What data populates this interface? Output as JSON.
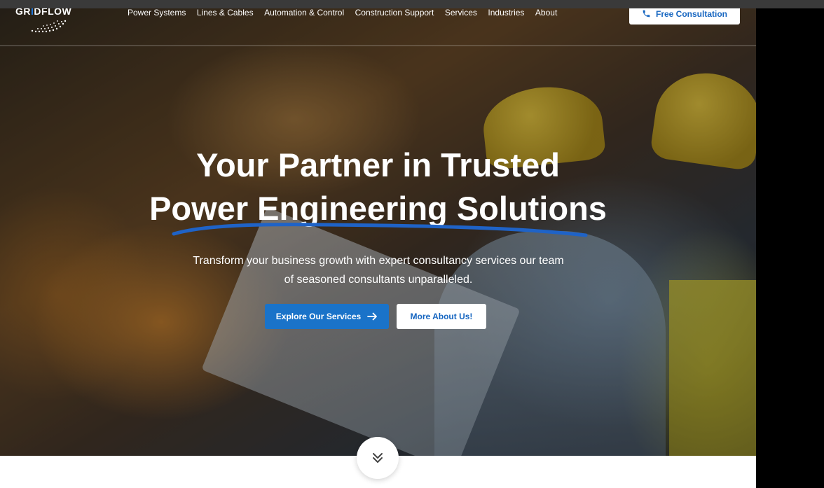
{
  "header": {
    "logo": {
      "text_left": "GR",
      "text_accent": "I",
      "text_mid": "D",
      "text_right": "FLOW",
      "icon": "lightning-dots-icon"
    },
    "nav_items": [
      {
        "label": "Power Systems"
      },
      {
        "label": "Lines & Cables"
      },
      {
        "label": "Automation & Control"
      },
      {
        "label": "Construction Support"
      },
      {
        "label": "Services"
      },
      {
        "label": "Industries"
      },
      {
        "label": "About"
      }
    ],
    "cta": {
      "label": "Free Consultation",
      "icon": "phone-icon"
    }
  },
  "hero": {
    "headline_line1": "Your Partner in Trusted",
    "headline_line2": "Power Engineering Solutions",
    "subtitle_line1": "Transform your business growth with expert consultancy services our team",
    "subtitle_line2": "of seasoned consultants unparalleled.",
    "primary_button": {
      "label": "Explore Our Services",
      "icon": "arrow-right-icon"
    },
    "secondary_button": {
      "label": "More About Us!"
    },
    "scroll_icon": "double-chevron-down-icon"
  },
  "colors": {
    "brand_blue": "#1a73c9",
    "link_blue": "#1565c0",
    "white": "#ffffff"
  }
}
